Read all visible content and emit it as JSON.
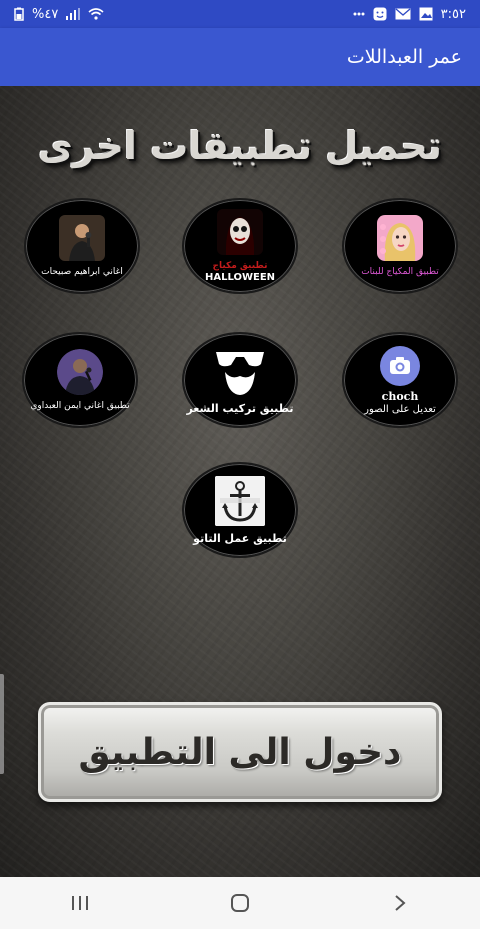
{
  "status_bar": {
    "time": "٣:٥٢",
    "battery": "%٤٧",
    "icons": [
      "battery-icon",
      "signal-icon",
      "wifi-icon",
      "notification-dot-icon",
      "photo-icon",
      "email-icon",
      "face-icon"
    ]
  },
  "app_bar": {
    "title": "عمر العبداللات"
  },
  "content": {
    "headline": "تحميل تطبيقات اخرى",
    "apps": [
      {
        "label": "اغاني ابراهيم صبيحات",
        "icon": "singer-photo-icon"
      },
      {
        "label": "تطبيق مكياج",
        "sublabel": "HALLOWEEN",
        "icon": "halloween-face-icon"
      },
      {
        "label": "تطبيق المكياج للبنات",
        "icon": "makeup-girl-icon"
      },
      {
        "label": "تطبيق اغاني ايمن العبداوي",
        "icon": "singer-mic-icon"
      },
      {
        "label": "تطبيق تركيب الشعر",
        "icon": "glasses-beard-icon"
      },
      {
        "label": "choch",
        "sublabel": "تعديل على الصور",
        "icon": "camera-icon"
      },
      {
        "label": "تطبيق عمل التاتو",
        "icon": "anchor-tattoo-icon"
      }
    ],
    "enter_button": "دخول الى التطبيق"
  },
  "nav_bar": {
    "buttons": [
      "recent-apps-icon",
      "home-icon",
      "back-icon"
    ]
  },
  "colors": {
    "status_bar": "#2f4ac4",
    "app_bar": "#3a57d0",
    "nav_bar": "#f6f6f6"
  }
}
